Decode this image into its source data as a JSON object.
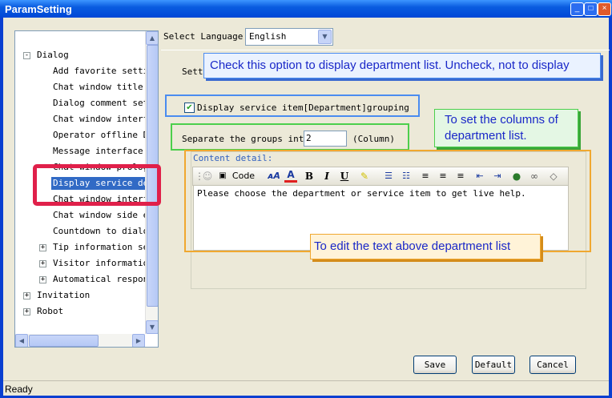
{
  "window": {
    "title": "ParamSetting"
  },
  "tree": {
    "items": [
      {
        "label": "Dialog",
        "level": 0,
        "expander": "-"
      },
      {
        "label": "Add favorite setting",
        "level": 1
      },
      {
        "label": "Chat window title se",
        "level": 1
      },
      {
        "label": "Dialog comment setti",
        "level": 1
      },
      {
        "label": "Chat window interfac",
        "level": 1
      },
      {
        "label": "Operator offline Dis",
        "level": 1
      },
      {
        "label": "Message interface se",
        "level": 1
      },
      {
        "label": "Chat window prologue",
        "level": 1
      },
      {
        "label": "Display service depa",
        "level": 1,
        "selected": true
      },
      {
        "label": "Chat window interfac",
        "level": 1
      },
      {
        "label": "Chat window side edg",
        "level": 1
      },
      {
        "label": "Countdown to dialog",
        "level": 1
      },
      {
        "label": "Tip information sett",
        "level": 1,
        "expander": "+"
      },
      {
        "label": "Visitor information",
        "level": 1,
        "expander": "+"
      },
      {
        "label": "Automatical response",
        "level": 1,
        "expander": "+"
      },
      {
        "label": "Invitation",
        "level": 0,
        "expander": "+"
      },
      {
        "label": "Robot",
        "level": 0,
        "expander": "+"
      }
    ]
  },
  "language": {
    "label": "Select Language",
    "value": "English"
  },
  "settings": {
    "section_label": "Sett",
    "group_checkbox_label": "Display service item[Department]grouping",
    "group_checked": true,
    "columns_label": "Separate the groups into:",
    "columns_value": "2",
    "columns_unit": "(Column)",
    "content_label": "Content detail:",
    "content_text": "Please choose the department or service item to get live help."
  },
  "editor_toolbar": {
    "code_label": "Code",
    "bold": "B",
    "italic": "I",
    "underline": "U"
  },
  "buttons": {
    "save": "Save",
    "default": "Default",
    "cancel": "Cancel"
  },
  "status": {
    "text": "Ready"
  },
  "callouts": {
    "checkbox_hint": "Check this option to display department list. Uncheck, not to display",
    "columns_hint": "To set the columns of department list.",
    "editor_hint": "To edit the text above department list"
  },
  "colors": {
    "callout_blue": "#4a8cf0",
    "callout_green": "#4ccf4c",
    "callout_orange": "#f0a830",
    "selection_red": "#e0204a",
    "tree_selected_bg": "#316ac5",
    "callout_text": "#1a28c8"
  },
  "icons": [
    "minimize-icon",
    "maximize-icon",
    "close-icon",
    "smiley-icon",
    "code-icon",
    "font-size-icon",
    "font-color-icon",
    "bold-icon",
    "italic-icon",
    "underline-icon",
    "highlight-icon",
    "numbered-list-icon",
    "bullet-list-icon",
    "align-left-icon",
    "align-center-icon",
    "align-right-icon",
    "outdent-icon",
    "indent-icon",
    "link-icon",
    "unlink-icon",
    "eraser-icon"
  ]
}
